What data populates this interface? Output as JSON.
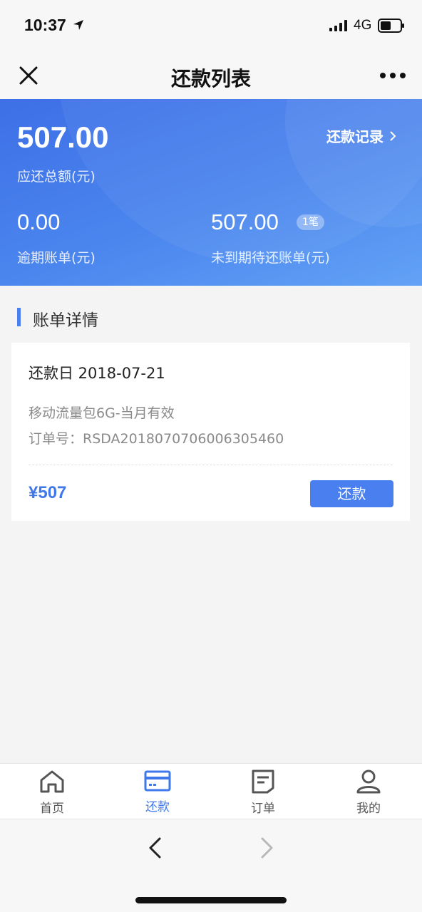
{
  "status_bar": {
    "time": "10:37",
    "network": "4G"
  },
  "nav": {
    "title": "还款列表"
  },
  "summary": {
    "total_amount": "507.00",
    "total_label": "应还总额(元)",
    "record_link": "还款记录",
    "overdue_amount": "0.00",
    "overdue_label": "逾期账单(元)",
    "pending_amount": "507.00",
    "pending_count_badge": "1笔",
    "pending_label": "未到期待还账单(元)"
  },
  "section": {
    "title": "账单详情"
  },
  "bill": {
    "due_date": "还款日 2018-07-21",
    "product": "移动流量包6G-当月有效",
    "order_no": "订单号：RSDA2018070706006305460",
    "price": "¥507",
    "pay_label": "还款"
  },
  "tabs": [
    {
      "label": "首页",
      "icon": "home-icon",
      "active": false
    },
    {
      "label": "还款",
      "icon": "card-icon",
      "active": true
    },
    {
      "label": "订单",
      "icon": "document-icon",
      "active": false
    },
    {
      "label": "我的",
      "icon": "person-icon",
      "active": false
    }
  ],
  "colors": {
    "accent": "#4a7ff0",
    "hero_start": "#3d6fe6",
    "hero_end": "#62a2f6",
    "price": "#3f78ea"
  }
}
